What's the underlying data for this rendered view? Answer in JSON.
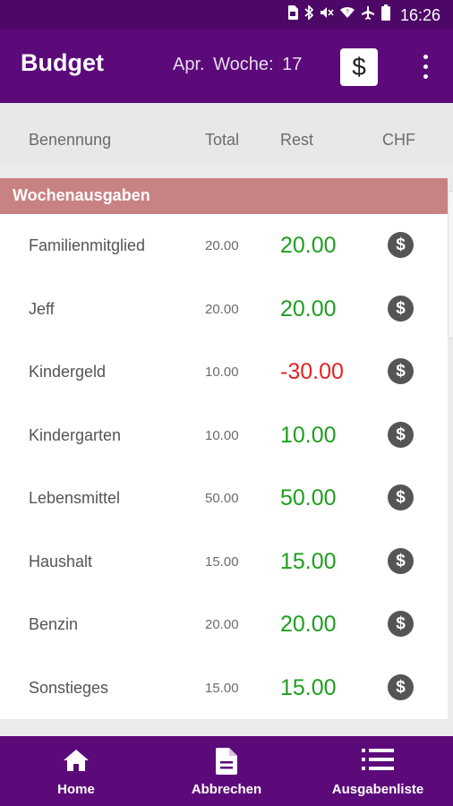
{
  "status_bar": {
    "time": "16:26",
    "icons": [
      "sim-icon",
      "bluetooth-icon",
      "mute-icon",
      "wifi-icon",
      "airplane-icon",
      "battery-icon"
    ]
  },
  "app_bar": {
    "title": "Budget",
    "week_label": "Apr. Woche: 17",
    "dollar_button": "$"
  },
  "columns": {
    "name": "Benennung",
    "total": "Total",
    "rest": "Rest",
    "currency": "CHF"
  },
  "section": {
    "title": "Wochenausgaben",
    "rows": [
      {
        "name": "Familienmitglied",
        "total": "20.00",
        "rest": "20.00",
        "status": "positive"
      },
      {
        "name": "Jeff",
        "total": "20.00",
        "rest": "20.00",
        "status": "positive"
      },
      {
        "name": "Kindergeld",
        "total": "10.00",
        "rest": "-30.00",
        "status": "negative"
      },
      {
        "name": "Kindergarten",
        "total": "10.00",
        "rest": "10.00",
        "status": "positive"
      },
      {
        "name": "Lebensmittel",
        "total": "50.00",
        "rest": "50.00",
        "status": "positive"
      },
      {
        "name": "Haushalt",
        "total": "15.00",
        "rest": "15.00",
        "status": "positive"
      },
      {
        "name": "Benzin",
        "total": "20.00",
        "rest": "20.00",
        "status": "positive"
      },
      {
        "name": "Sonstieges",
        "total": "15.00",
        "rest": "15.00",
        "status": "positive"
      }
    ]
  },
  "bottom_nav": {
    "home": "Home",
    "cancel": "Abbrechen",
    "list": "Ausgabenliste"
  },
  "colors": {
    "primary": "#5c0a7a",
    "status_bar": "#4d0766",
    "section_header": "#c98283",
    "positive": "#1e9e1e",
    "negative": "#e52222"
  }
}
